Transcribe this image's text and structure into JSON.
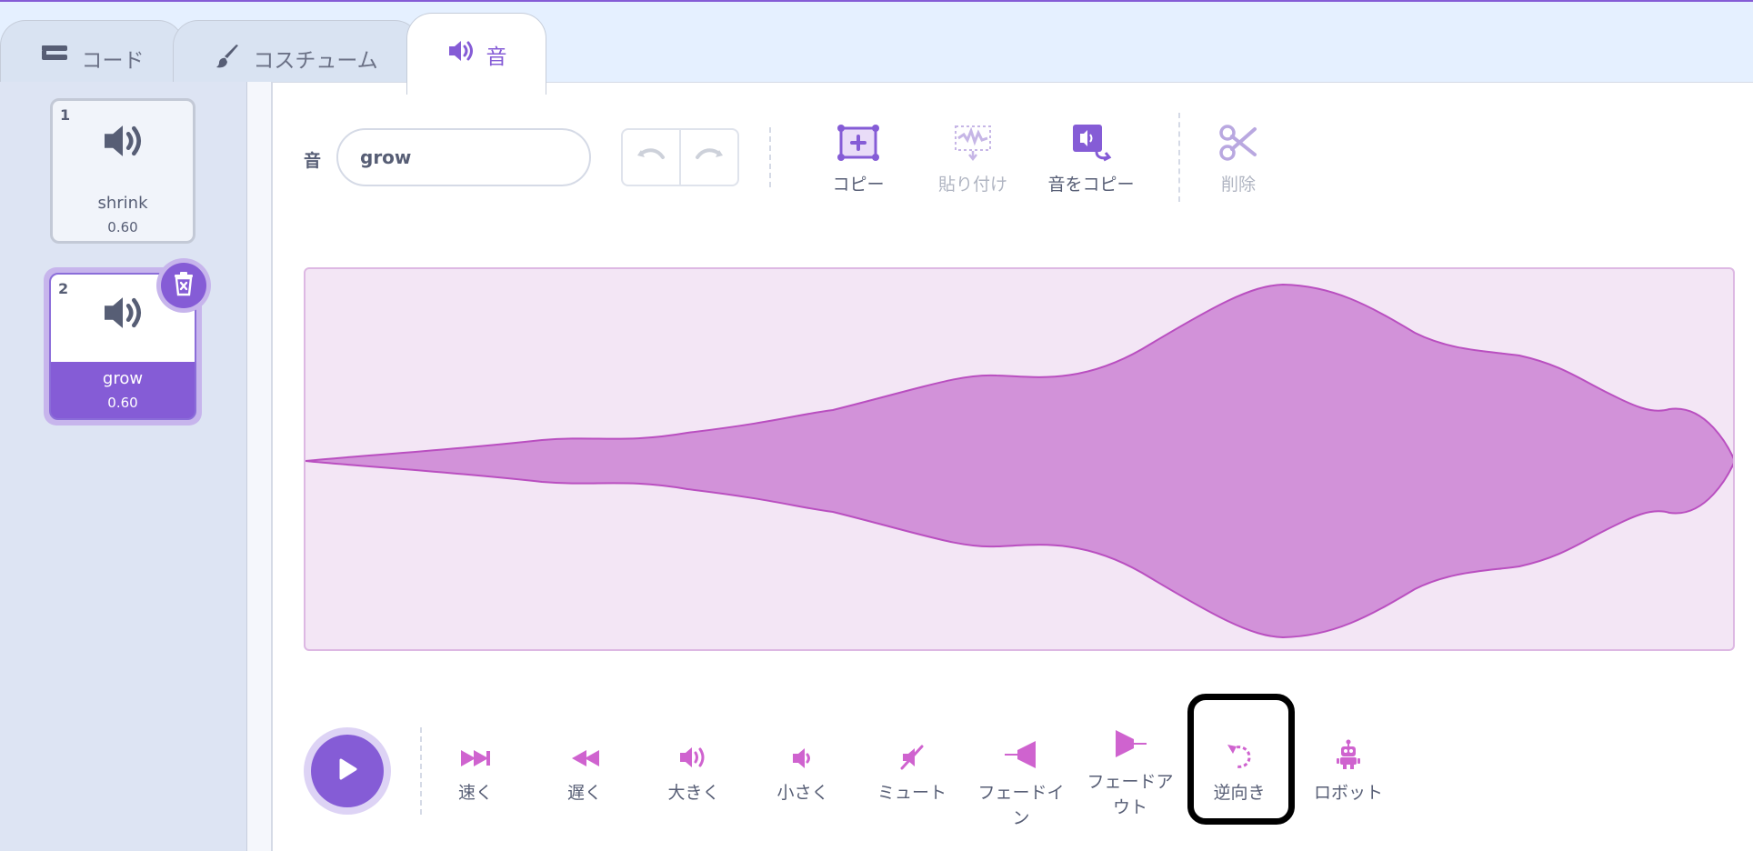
{
  "tabs": [
    {
      "label": "コード",
      "icon": "code-blocks-icon"
    },
    {
      "label": "コスチューム",
      "icon": "paintbrush-icon"
    },
    {
      "label": "音",
      "icon": "speaker-icon"
    }
  ],
  "sounds": [
    {
      "index": "1",
      "name": "shrink",
      "duration": "0.60",
      "selected": false
    },
    {
      "index": "2",
      "name": "grow",
      "duration": "0.60",
      "selected": true
    }
  ],
  "editor": {
    "name_label": "音",
    "name_value": "grow",
    "tools": {
      "copy": "コピー",
      "paste": "貼り付け",
      "copy_sound": "音をコピー",
      "delete": "削除"
    }
  },
  "effects": {
    "faster": "速く",
    "slower": "遅く",
    "louder": "大きく",
    "softer": "小さく",
    "mute": "ミュート",
    "fade_in": "フェードイン",
    "fade_out": "フェードアウト",
    "reverse": "逆向き",
    "robot": "ロボット"
  },
  "colors": {
    "accent": "#855cd6",
    "waveform_fill": "#d292d9",
    "waveform_bg": "#f3e6f5",
    "effect_icon": "#cf63cf"
  }
}
